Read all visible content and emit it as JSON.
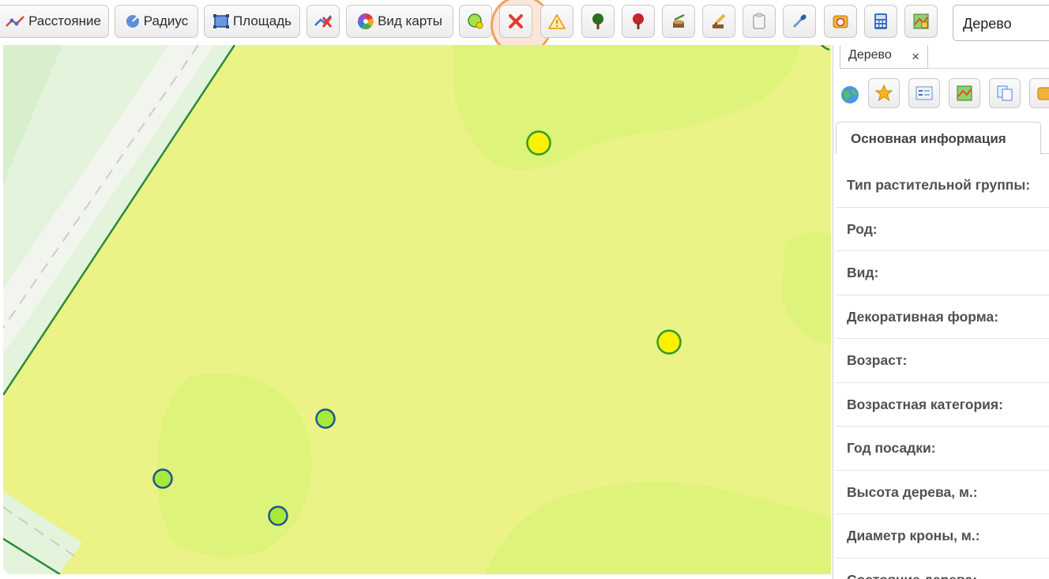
{
  "toolbar": {
    "distance_label": "Расстояние",
    "radius_label": "Радиус",
    "area_label": "Площадь",
    "map_view_label": "Вид карты",
    "layer_select_value": "Дерево",
    "highlight_color": "#f0a25c"
  },
  "panel": {
    "tab_label": "Дерево",
    "tab_close": "×",
    "info_tab_label": "Основная информация",
    "fields": [
      "Тип растительной группы:",
      "Род:",
      "Вид:",
      "Декоративная форма:",
      "Возраст:",
      "Возрастная категория:",
      "Год посадки:",
      "Высота дерева, м.:",
      "Диаметр кроны, м.:",
      "Состояние дерева:"
    ]
  },
  "map": {
    "colors": {
      "lawn": "#ebf387",
      "patch": "#def37a",
      "road": "#e7f4de",
      "outline": "#2c8a3a"
    },
    "markers": [
      {
        "kind": "yellow-tree",
        "fill": "#ffef00",
        "stroke": "#2f9a32"
      },
      {
        "kind": "yellow-tree",
        "fill": "#ffef00",
        "stroke": "#2f9a32"
      },
      {
        "kind": "green-tree",
        "fill": "#a6ea3c",
        "stroke": "#23558f"
      },
      {
        "kind": "green-tree",
        "fill": "#a6ea3c",
        "stroke": "#23558f"
      },
      {
        "kind": "green-tree",
        "fill": "#a6ea3c",
        "stroke": "#23558f"
      }
    ]
  }
}
